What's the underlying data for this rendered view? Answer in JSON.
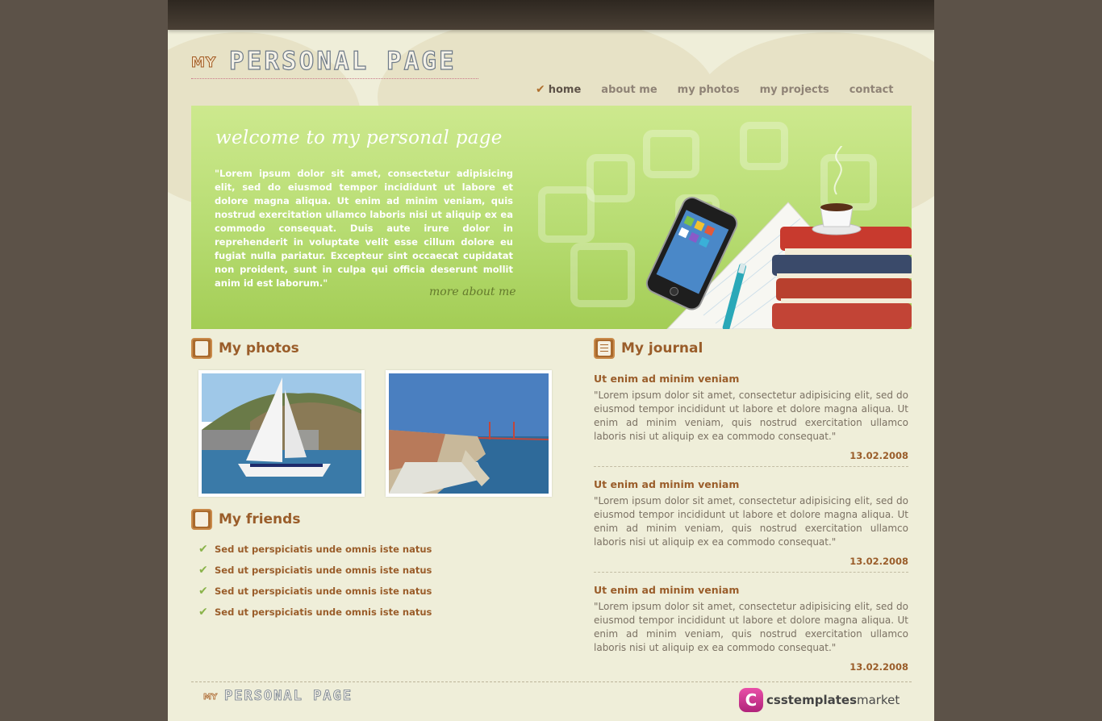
{
  "site": {
    "logo_prefix": "MY",
    "logo_main": "PERSONAL PAGE"
  },
  "nav": {
    "items": [
      {
        "label": "home",
        "active": true
      },
      {
        "label": "about me",
        "active": false
      },
      {
        "label": "my photos",
        "active": false
      },
      {
        "label": "my projects",
        "active": false
      },
      {
        "label": "contact",
        "active": false
      }
    ]
  },
  "banner": {
    "title": "welcome to my personal page",
    "text": "\"Lorem ipsum dolor sit amet, consectetur adipisicing elit, sed do eiusmod tempor incididunt ut labore et dolore magna aliqua. Ut enim ad minim veniam, quis nostrud exercitation ullamco laboris nisi ut aliquip ex ea commodo consequat. Duis aute irure dolor in reprehenderit in voluptate velit esse cillum dolore eu fugiat nulla pariatur. Excepteur sint occaecat cupidatat non proident, sunt in culpa qui officia deserunt mollit anim id est laborum.\"",
    "more_link": "more about me"
  },
  "photos": {
    "heading": "My photos"
  },
  "friends": {
    "heading": "My friends",
    "items": [
      "Sed ut perspiciatis unde omnis iste natus",
      "Sed ut perspiciatis unde omnis iste natus",
      "Sed ut perspiciatis unde omnis iste natus",
      "Sed ut perspiciatis unde omnis iste natus"
    ]
  },
  "journal": {
    "heading": "My journal",
    "entries": [
      {
        "title": "Ut enim ad minim veniam",
        "text": "\"Lorem ipsum dolor sit amet, consectetur adipisicing elit, sed do eiusmod tempor incididunt ut labore et dolore magna aliqua. Ut enim ad minim veniam, quis nostrud exercitation ullamco laboris nisi ut aliquip ex ea commodo consequat.\"",
        "date": "13.02.2008"
      },
      {
        "title": "Ut enim ad minim veniam",
        "text": "\"Lorem ipsum dolor sit amet, consectetur adipisicing elit, sed do eiusmod tempor incididunt ut labore et dolore magna aliqua. Ut enim ad minim veniam, quis nostrud exercitation ullamco laboris nisi ut aliquip ex ea commodo consequat.\"",
        "date": "13.02.2008"
      },
      {
        "title": "Ut enim ad minim veniam",
        "text": "\"Lorem ipsum dolor sit amet, consectetur adipisicing elit, sed do eiusmod tempor incididunt ut labore et dolore magna aliqua. Ut enim ad minim veniam, quis nostrud exercitation ullamco laboris nisi ut aliquip ex ea commodo consequat.\"",
        "date": "13.02.2008"
      }
    ]
  },
  "footer": {
    "logo_prefix": "MY",
    "logo_main": "PERSONAL PAGE",
    "brand_icon": "C",
    "brand_bold": "csstemplates",
    "brand_rest": "market"
  },
  "icons": {
    "nav_active": "checkmark-icon",
    "section_photos": "person-icon",
    "section_friends": "person-icon",
    "section_journal": "notepad-icon",
    "friend_bullet": "checkmark-icon"
  },
  "colors": {
    "page_bg": "#5c5248",
    "content_bg": "#efeed9",
    "accent": "#9a5d2a",
    "banner_green": "#b7dc72"
  }
}
